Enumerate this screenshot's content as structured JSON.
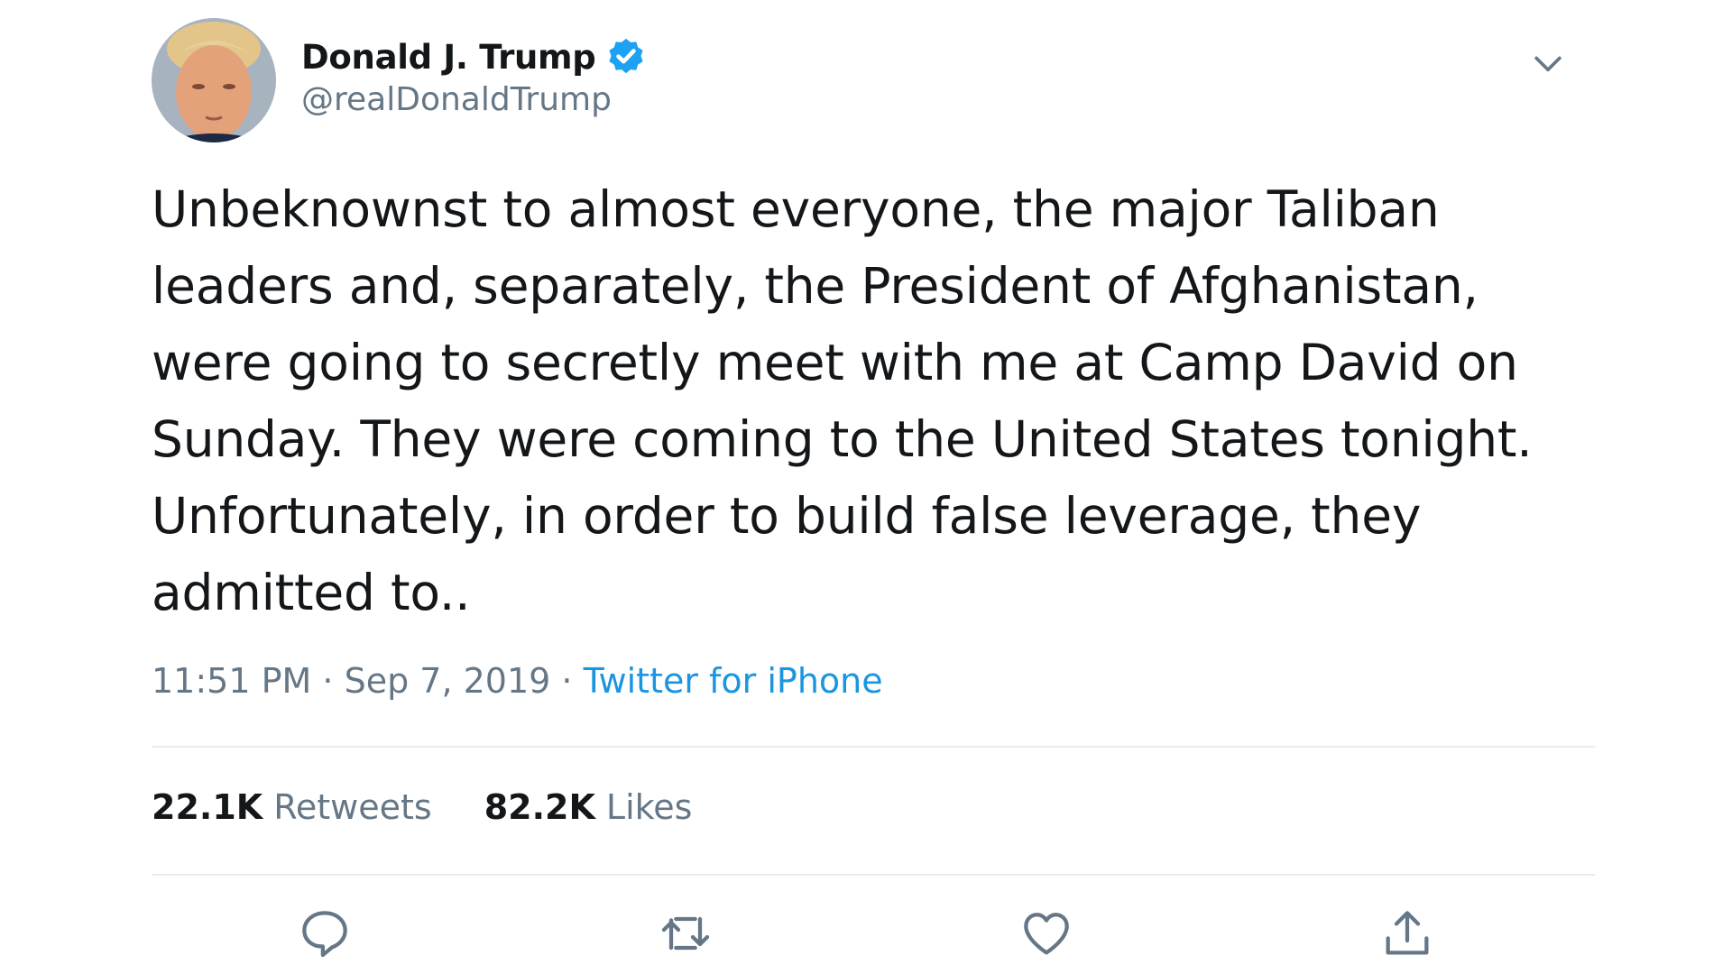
{
  "author": {
    "display_name": "Donald J. Trump",
    "handle": "@realDonaldTrump",
    "verified": true
  },
  "tweet": {
    "text": "Unbeknownst to almost everyone, the major Taliban\nleaders and, separately, the President of Afghanistan,\nwere going to secretly meet with me at Camp David on\nSunday. They were coming to the United States tonight.\nUnfortunately, in order to build false leverage, they\nadmitted to..",
    "time": "11:51 PM",
    "separator": "·",
    "date": "Sep 7, 2019",
    "source": "Twitter for iPhone"
  },
  "stats": {
    "retweets_count": "22.1K",
    "retweets_label": "Retweets",
    "likes_count": "82.2K",
    "likes_label": "Likes"
  },
  "actions": [
    {
      "name": "reply",
      "icon": "reply-icon"
    },
    {
      "name": "retweet",
      "icon": "retweet-icon"
    },
    {
      "name": "like",
      "icon": "heart-icon"
    },
    {
      "name": "share",
      "icon": "share-icon"
    }
  ],
  "colors": {
    "text_primary": "#14171a",
    "text_secondary": "#657786",
    "accent": "#1b95e0",
    "verified": "#1da1f2",
    "divider": "#e6ecf0",
    "icon": "#657786"
  }
}
